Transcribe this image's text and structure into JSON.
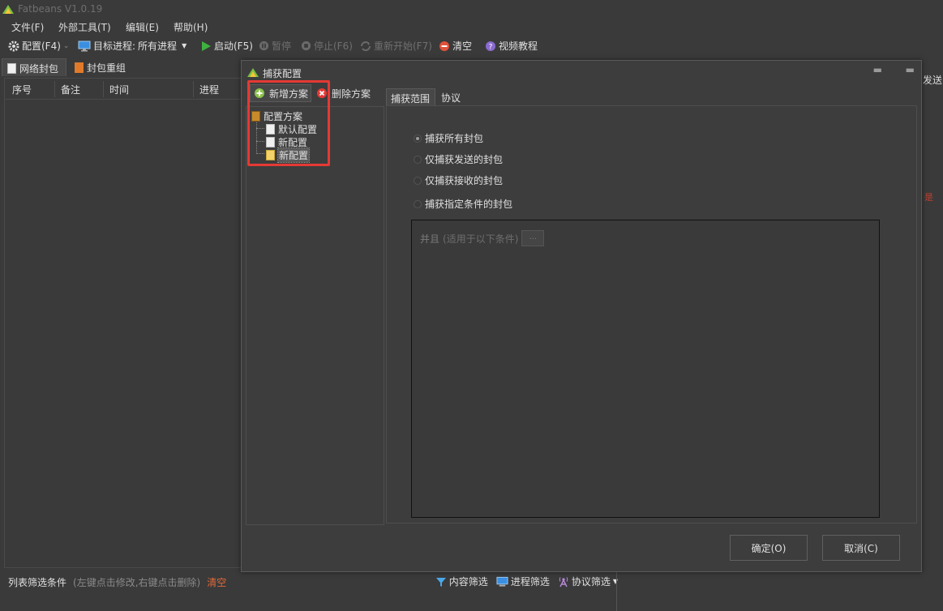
{
  "app": {
    "title": "Fatbeans V1.0.19"
  },
  "menu": [
    "文件(F)",
    "外部工具(T)",
    "编辑(E)",
    "帮助(H)"
  ],
  "toolbar": {
    "config": "配置(F4)",
    "target_label": "目标进程:",
    "target_value": "所有进程",
    "start": "启动(F5)",
    "pause": "暂停",
    "stop": "停止(F6)",
    "restart": "重新开始(F7)",
    "clear": "清空",
    "tutorial": "视频教程"
  },
  "main_tabs": [
    "网络封包",
    "封包重组"
  ],
  "list_columns": [
    "序号",
    "备注",
    "时间",
    "进程"
  ],
  "status": {
    "label": "列表筛选条件",
    "hint": "(左键点击修改,右键点击删除)",
    "clear": "清空",
    "content_filter": "内容筛选",
    "process_filter": "进程筛选",
    "protocol_filter": "协议筛选"
  },
  "background": {
    "send_label": "发送",
    "mark": "是"
  },
  "dialog": {
    "title": "捕获配置",
    "add_scheme": "新增方案",
    "delete_scheme": "删除方案",
    "tree": {
      "root": "配置方案",
      "items": [
        "默认配置",
        "新配置",
        "新配置"
      ]
    },
    "tabs": [
      "捕获范围",
      "协议"
    ],
    "radios": [
      "捕获所有封包",
      "仅捕获发送的封包",
      "仅捕获接收的封包",
      "捕获指定条件的封包"
    ],
    "condition": {
      "op": "并且",
      "hint": "(适用于以下条件)",
      "btn": "..."
    },
    "ok": "确定(O)",
    "cancel": "取消(C)"
  },
  "colors": {
    "background": "#3a3a3a",
    "accent_red": "#e53935",
    "start_green": "#3fb13f",
    "clear_red": "#e0523a"
  }
}
